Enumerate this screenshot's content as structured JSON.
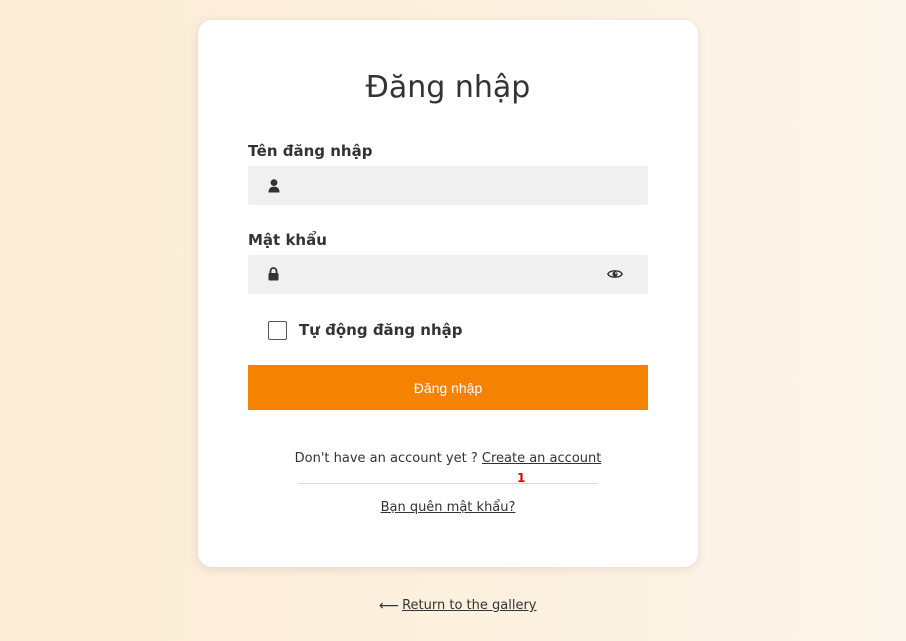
{
  "login": {
    "title": "Đăng nhập",
    "username_label": "Tên đăng nhập",
    "username_value": "",
    "password_label": "Mật khẩu",
    "password_value": "",
    "remember_label": "Tự động đăng nhập",
    "remember_checked": false,
    "submit_label": "Đăng nhập"
  },
  "signup": {
    "prompt": "Don't have an account yet ?",
    "link_label": "Create an account",
    "badge": "1"
  },
  "forgot": {
    "label": "Bạn quên mật khẩu?"
  },
  "footer": {
    "arrow": "⟵",
    "return_label": "Return to the gallery"
  },
  "icons": {
    "username": "user-icon",
    "password": "lock-icon",
    "toggle_password": "eye-icon",
    "return": "arrow-left-icon"
  },
  "colors": {
    "primary_button": "#f58200",
    "badge": "#e00000",
    "input_background": "#f0f0f0"
  }
}
